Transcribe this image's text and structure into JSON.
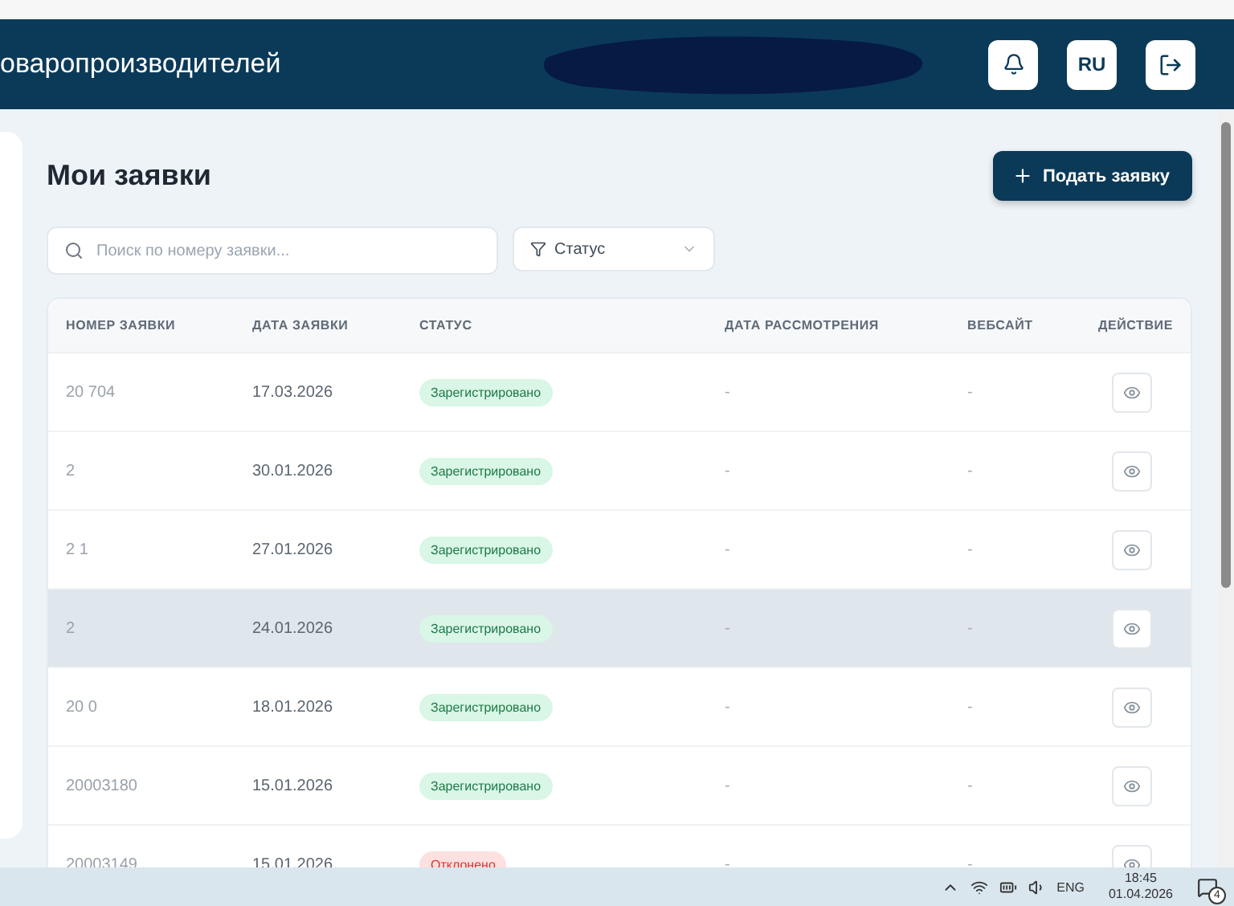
{
  "header": {
    "title": "оваропроизводителей",
    "language": "RU"
  },
  "page": {
    "title": "Мои заявки",
    "new_button": "Подать заявку",
    "search": {
      "placeholder": "Поиск по номеру заявки..."
    },
    "status_filter": "Статус"
  },
  "table": {
    "columns": [
      "НОМЕР ЗАЯВКИ",
      "ДАТА ЗАЯВКИ",
      "СТАТУС",
      "ДАТА РАССМОТРЕНИЯ",
      "ВЕБСАЙТ",
      "ДЕЙСТВИЕ"
    ],
    "rows": [
      {
        "number": "20 704",
        "date": "17.03.2026",
        "status": "Зарегистрировано",
        "kind": "registered",
        "review_date": "-",
        "website": "-",
        "selected": false
      },
      {
        "number": "2",
        "date": "30.01.2026",
        "status": "Зарегистрировано",
        "kind": "registered",
        "review_date": "-",
        "website": "-",
        "selected": false
      },
      {
        "number": "2 1",
        "date": "27.01.2026",
        "status": "Зарегистрировано",
        "kind": "registered",
        "review_date": "-",
        "website": "-",
        "selected": false
      },
      {
        "number": "2",
        "date": "24.01.2026",
        "status": "Зарегистрировано",
        "kind": "registered",
        "review_date": "-",
        "website": "-",
        "selected": true
      },
      {
        "number": "20 0",
        "date": "18.01.2026",
        "status": "Зарегистрировано",
        "kind": "registered",
        "review_date": "-",
        "website": "-",
        "selected": false
      },
      {
        "number": "20003180",
        "date": "15.01.2026",
        "status": "Зарегистрировано",
        "kind": "registered",
        "review_date": "-",
        "website": "-",
        "selected": false
      },
      {
        "number": "20003149",
        "date": "15.01.2026",
        "status": "Отклонено",
        "kind": "rejected",
        "review_date": "-",
        "website": "-",
        "selected": false
      }
    ]
  },
  "taskbar": {
    "language": "ENG",
    "time": "18:45",
    "date": "01.04.2026",
    "notifications": "4"
  }
}
